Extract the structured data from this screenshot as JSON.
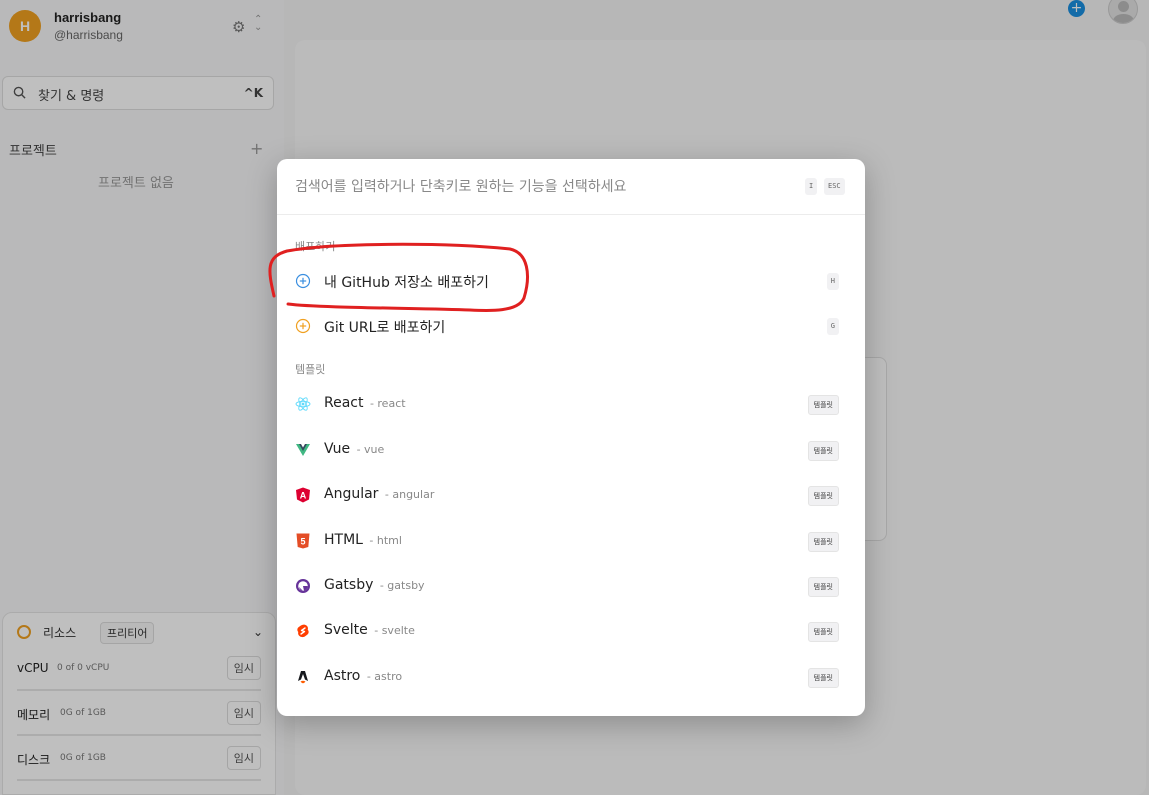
{
  "user": {
    "initial": "H",
    "name": "harrisbang",
    "handle": "@harrisbang"
  },
  "search": {
    "label": "찾기 & 명령",
    "shortcut": "^K"
  },
  "projects": {
    "title": "프로젝트",
    "add": "+",
    "empty": "프로젝트 없음"
  },
  "resources": {
    "title": "리소스",
    "tier": "프리티어",
    "rows": [
      {
        "name": "vCPU",
        "value": "0 of 0 vCPU",
        "button": "임시"
      },
      {
        "name": "메모리",
        "value": "0G of 1GB",
        "button": "임시"
      },
      {
        "name": "디스크",
        "value": "0G of 1GB",
        "button": "임시"
      }
    ]
  },
  "topbar": {
    "plus": "+"
  },
  "palette": {
    "placeholder": "검색어를 입력하거나 단축키로 원하는 기능을 선택하세요",
    "key_i": "I",
    "key_esc": "ESC",
    "deploy_section": "배포하기",
    "deploy_items": [
      {
        "label": "내 GitHub 저장소 배포하기",
        "key": "H",
        "icon": "plus-circle-blue-icon",
        "color": "#3b8fe0"
      },
      {
        "label": "Git URL로 배포하기",
        "key": "G",
        "icon": "plus-circle-orange-icon",
        "color": "#f0a020"
      }
    ],
    "template_section": "템플릿",
    "templates": [
      {
        "name": "React",
        "sub": "- react",
        "tag": "템플릿",
        "icon": "react-icon",
        "color": "#61dafb"
      },
      {
        "name": "Vue",
        "sub": "- vue",
        "tag": "템플릿",
        "icon": "vue-icon",
        "color": "#41b883"
      },
      {
        "name": "Angular",
        "sub": "- angular",
        "tag": "템플릿",
        "icon": "angular-icon",
        "color": "#dd0031"
      },
      {
        "name": "HTML",
        "sub": "- html",
        "tag": "템플릿",
        "icon": "html5-icon",
        "color": "#e44d26"
      },
      {
        "name": "Gatsby",
        "sub": "- gatsby",
        "tag": "템플릿",
        "icon": "gatsby-icon",
        "color": "#663399"
      },
      {
        "name": "Svelte",
        "sub": "- svelte",
        "tag": "템플릿",
        "icon": "svelte-icon",
        "color": "#ff3e00"
      },
      {
        "name": "Astro",
        "sub": "- astro",
        "tag": "템플릿",
        "icon": "astro-icon",
        "color": "#17191e"
      }
    ]
  },
  "annotation_color": "#e02020"
}
